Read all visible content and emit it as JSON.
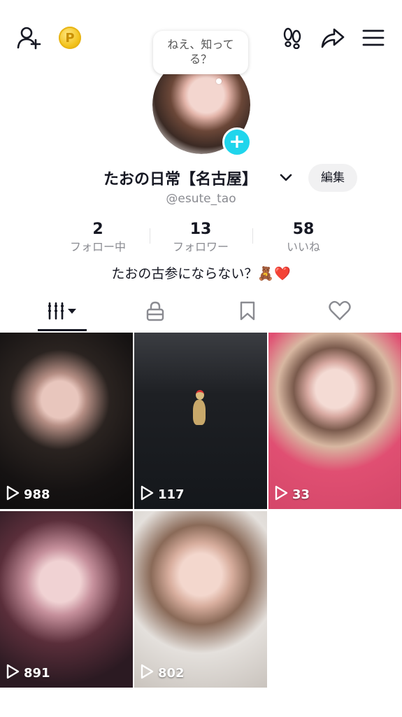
{
  "bubble": {
    "text": "ねえ、知ってる？"
  },
  "profile": {
    "name": "たおの日常【名古屋】",
    "handle": "@esute_tao",
    "edit_label": "編集",
    "bio": "たおの古参にならない？🧸❤️"
  },
  "stats": [
    {
      "value": "2",
      "label": "フォロー中"
    },
    {
      "value": "13",
      "label": "フォロワー"
    },
    {
      "value": "58",
      "label": "いいね"
    }
  ],
  "icons": {
    "add_friend": "add-user-icon",
    "coin": "coin-icon",
    "footprints": "footprints-icon",
    "share": "share-icon",
    "menu": "hamburger-menu-icon",
    "avatar_plus": "plus-icon",
    "tab_videos": "grid-icon",
    "tab_private": "lock-icon",
    "tab_saved": "bookmark-icon",
    "tab_liked": "heart-icon"
  },
  "colors": {
    "accent": "#20d5ec",
    "text": "#161823",
    "muted": "#8a8b91"
  },
  "videos": [
    {
      "views": "988"
    },
    {
      "views": "117"
    },
    {
      "views": "33"
    },
    {
      "views": "891"
    },
    {
      "views": "802"
    }
  ]
}
